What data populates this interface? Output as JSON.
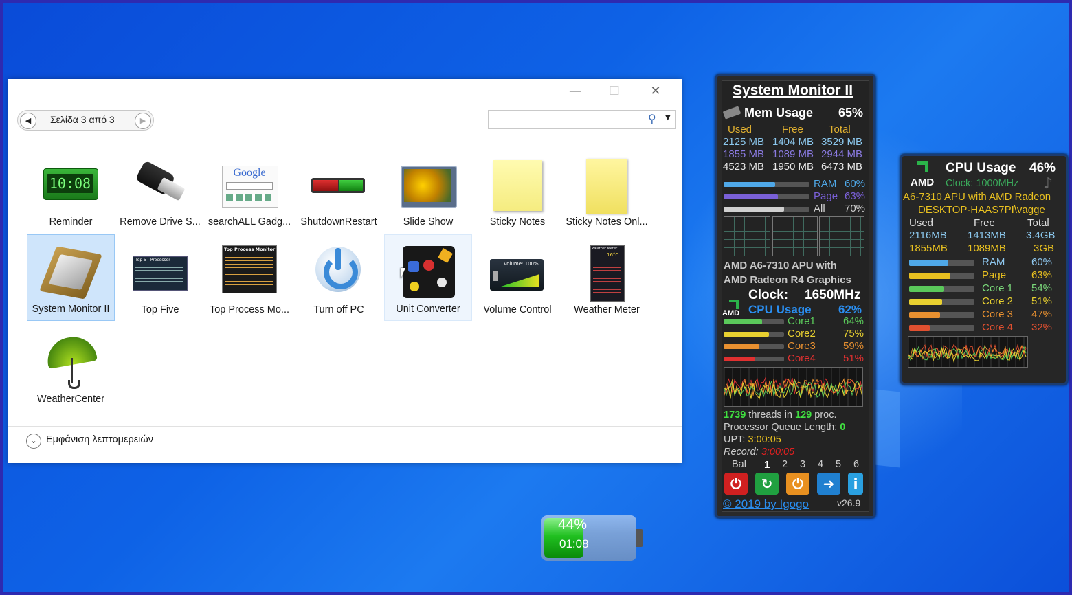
{
  "window": {
    "page_indicator": "Σελίδα 3 από 3",
    "search_placeholder": "",
    "details_label": "Εμφάνιση λεπτομερειών",
    "gadgets": [
      {
        "label": "Reminder",
        "icon": "reminder-clock-icon"
      },
      {
        "label": "Remove Drive S...",
        "icon": "usb-drive-icon"
      },
      {
        "label": "searchALL Gadg...",
        "icon": "google-search-icon"
      },
      {
        "label": "ShutdownRestart",
        "icon": "shutdown-switch-icon"
      },
      {
        "label": "Slide Show",
        "icon": "slideshow-photo-icon"
      },
      {
        "label": "Sticky Notes",
        "icon": "sticky-note-icon"
      },
      {
        "label": "Sticky Notes Onl...",
        "icon": "sticky-note-online-icon"
      },
      {
        "label": "System Monitor II",
        "icon": "cpu-chip-icon"
      },
      {
        "label": "Top Five",
        "icon": "top-five-icon"
      },
      {
        "label": "Top Process Mo...",
        "icon": "top-process-icon"
      },
      {
        "label": "Turn off PC",
        "icon": "power-icon"
      },
      {
        "label": "Unit Converter",
        "icon": "unit-converter-icon"
      },
      {
        "label": "Volume Control",
        "icon": "volume-icon"
      },
      {
        "label": "Weather Meter",
        "icon": "weather-meter-icon"
      },
      {
        "label": "WeatherCenter",
        "icon": "umbrella-icon"
      }
    ],
    "icon_texts": {
      "reminder": "10:08",
      "google": "Google",
      "top_five_title": "Top 5 - Processor",
      "top_process_title": "Top Process Monitor",
      "volume": "Volume: 100%",
      "weather_meter": "Weather Meter",
      "weather_temp": "16°C"
    }
  },
  "system_monitor": {
    "title": "System Monitor II",
    "mem_label": "Mem Usage",
    "mem_pct": "65%",
    "headers": [
      "Used",
      "Free",
      "Total"
    ],
    "rows": [
      [
        "2125 MB",
        "1404 MB",
        "3529 MB"
      ],
      [
        "1855 MB",
        "1089 MB",
        "2944 MB"
      ],
      [
        "4523 MB",
        "1950 MB",
        "6473 MB"
      ]
    ],
    "bars": [
      {
        "label": "RAM",
        "value": "60%",
        "fill": 0.6,
        "color": "#4fa8e8"
      },
      {
        "label": "Page",
        "value": "63%",
        "fill": 0.63,
        "color": "#7a60d8"
      },
      {
        "label": "All",
        "value": "70%",
        "fill": 0.7,
        "color": "#d0d0d0"
      }
    ],
    "cpu_name_1": "AMD A6-7310 APU with",
    "cpu_name_2": "AMD Radeon R4 Graphics",
    "clock_label": "Clock:",
    "clock_value": "1650MHz",
    "amd_logo": "AMD",
    "cpu_label": "CPU Usage",
    "cpu_pct": "62%",
    "cores": [
      {
        "label": "Core1",
        "value": "64%",
        "fill": 0.64,
        "color": "#5ac85a"
      },
      {
        "label": "Core2",
        "value": "75%",
        "fill": 0.75,
        "color": "#e8d030"
      },
      {
        "label": "Core3",
        "value": "59%",
        "fill": 0.59,
        "color": "#e89030"
      },
      {
        "label": "Core4",
        "value": "51%",
        "fill": 0.51,
        "color": "#e03030"
      }
    ],
    "threads": "1739",
    "threads_text": "threads in",
    "procs": "129",
    "procs_text": "proc.",
    "queue_label": "Processor Queue Length:",
    "queue_value": "0",
    "upt_label": "UPT:",
    "upt_value": "3:00:05",
    "record_label": "Record:",
    "record_value": "3:00:05",
    "bal_label": "Bal",
    "pages": [
      "1",
      "2",
      "3",
      "4",
      "5",
      "6"
    ],
    "copyright": "© 2019 by Igogo",
    "version": "v26.9"
  },
  "cpu_usage": {
    "logo": "AMD",
    "title": "CPU Usage",
    "pct": "46%",
    "clock": "Clock: 1000MHz",
    "name_1": "A6-7310 APU with AMD Radeon",
    "name_2": "DESKTOP-HAAS7PI\\vagge",
    "headers": [
      "Used",
      "Free",
      "Total"
    ],
    "row1": [
      "2116MB",
      "1413MB",
      "3.4GB"
    ],
    "row2": [
      "1855MB",
      "1089MB",
      "3GB"
    ],
    "bars": [
      {
        "label": "RAM",
        "value": "60%",
        "fill": 0.6,
        "color": "#4fa8e8",
        "textcolor": "#8fc8f0"
      },
      {
        "label": "Page",
        "value": "63%",
        "fill": 0.63,
        "color": "#e8c020",
        "textcolor": "#e8c020"
      },
      {
        "label": "Core 1",
        "value": "54%",
        "fill": 0.54,
        "color": "#5ac85a",
        "textcolor": "#7ad87a"
      },
      {
        "label": "Core 2",
        "value": "51%",
        "fill": 0.51,
        "color": "#e8d030",
        "textcolor": "#e8d030"
      },
      {
        "label": "Core 3",
        "value": "47%",
        "fill": 0.47,
        "color": "#e89030",
        "textcolor": "#e89030"
      },
      {
        "label": "Core 4",
        "value": "32%",
        "fill": 0.32,
        "color": "#e05030",
        "textcolor": "#e05030"
      }
    ]
  },
  "battery": {
    "percent": "44%",
    "time": "01:08",
    "level": 0.44
  }
}
